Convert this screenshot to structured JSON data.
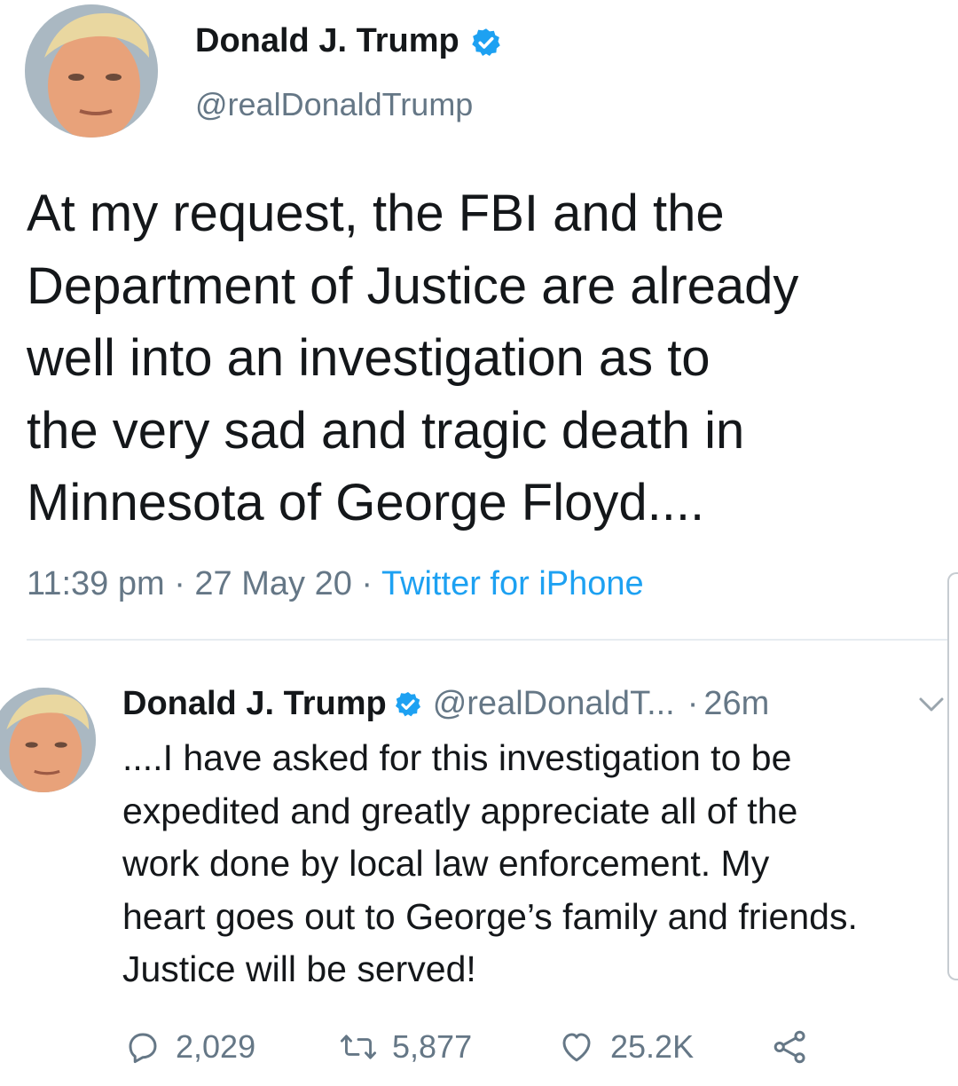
{
  "main_tweet": {
    "author_name": "Donald J. Trump",
    "handle": "@realDonaldTrump",
    "text_lines": [
      "At my request, the FBI and the",
      "Department of Justice are already",
      "well into an investigation as to",
      "the very sad and tragic death in",
      "Minnesota of George Floyd...."
    ],
    "time": "11:39 pm",
    "date": "27 May 20",
    "separator": "·",
    "source": "Twitter for iPhone",
    "avatar_icon": "profile-photo",
    "verified_icon": "verified-badge-icon"
  },
  "reply_tweet": {
    "author_name": "Donald J. Trump",
    "handle": "@realDonaldT...",
    "separator": "·",
    "time_ago": "26m",
    "text_lines": [
      "....I have asked for this investigation to be",
      "expedited and greatly appreciate all of the",
      "work done by local law enforcement. My",
      "heart goes out to George’s family and friends.",
      "Justice will be served!"
    ],
    "actions": {
      "replies": "2,029",
      "retweets": "5,877",
      "likes": "25.2K"
    },
    "avatar_icon": "profile-photo",
    "menu_icon": "chevron-down-icon"
  },
  "colors": {
    "text": "#14171a",
    "secondary": "#657786",
    "link": "#1da1f2",
    "verified": "#1da1f2",
    "divider": "#e6ecf0"
  }
}
